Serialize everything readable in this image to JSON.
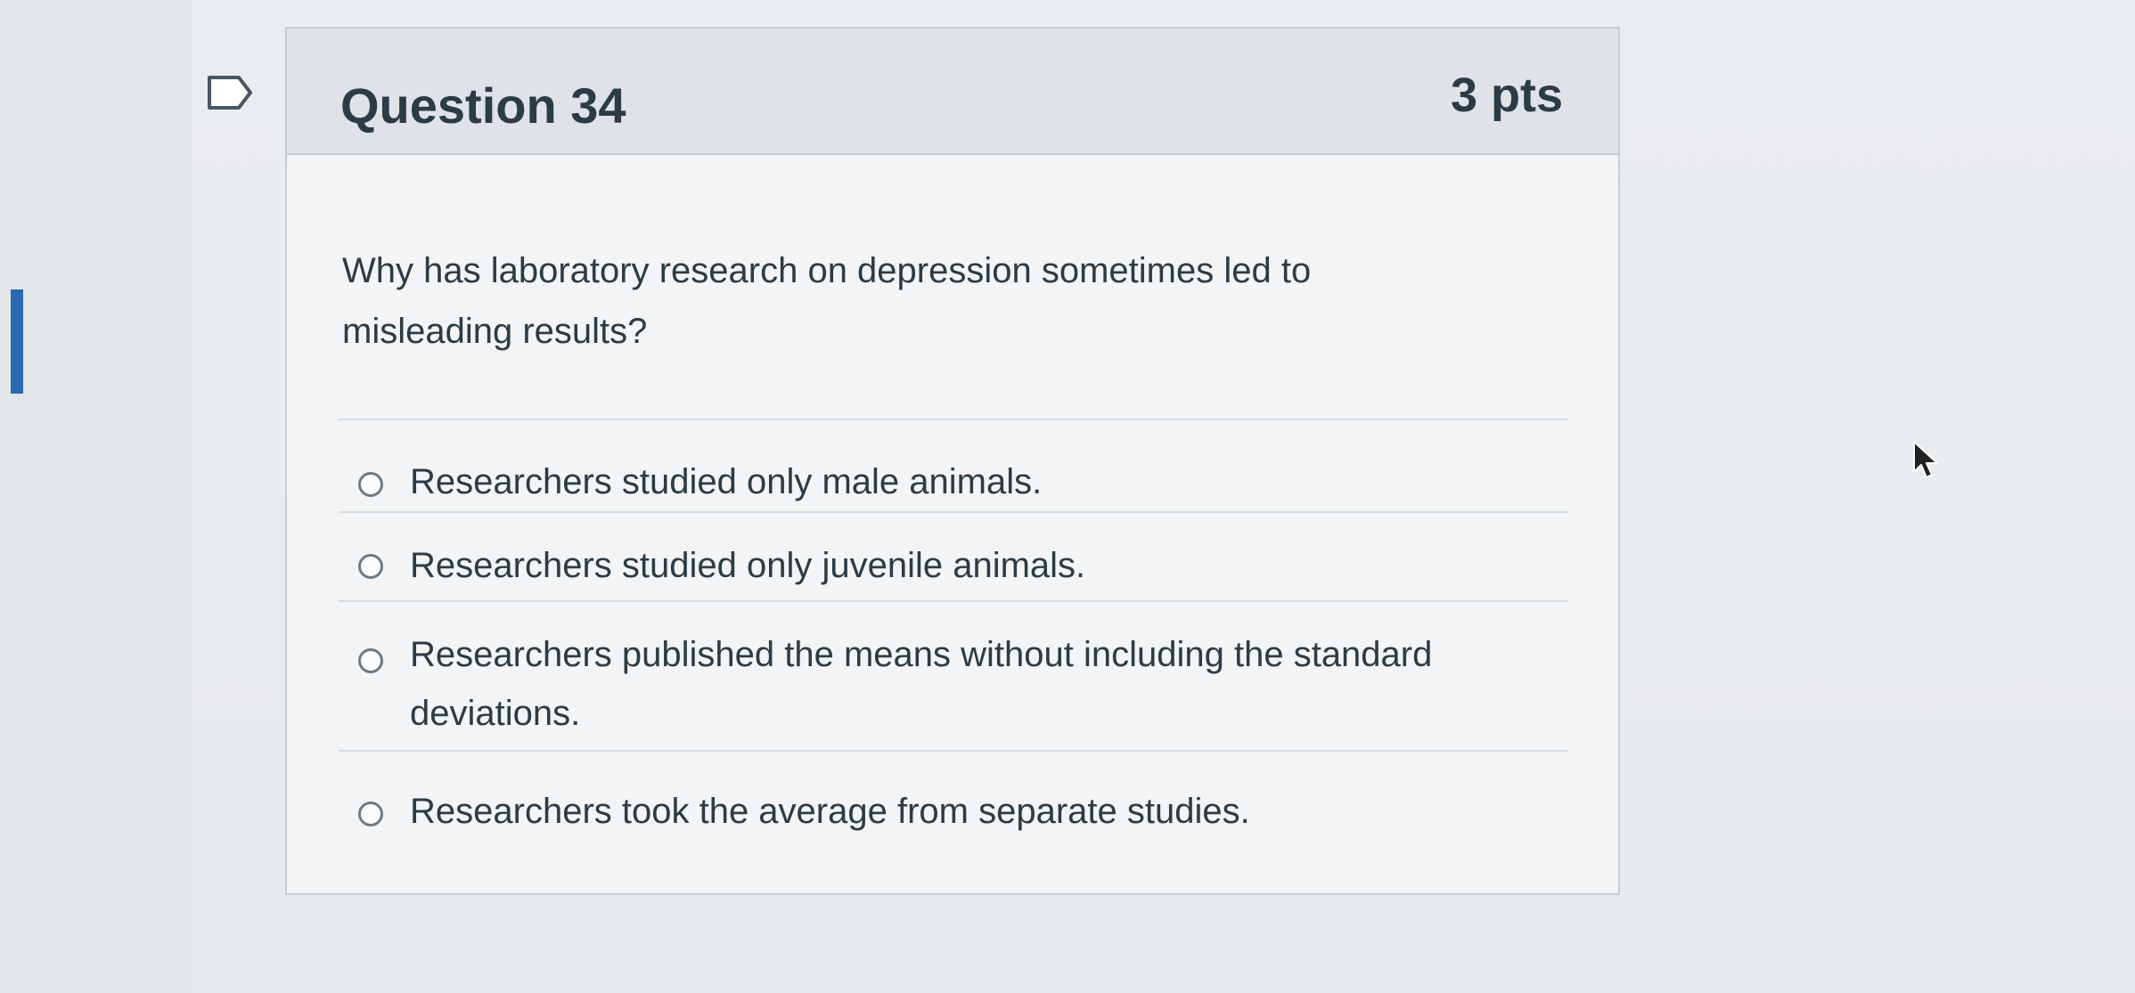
{
  "question": {
    "title": "Question 34",
    "points": "3 pts",
    "text": "Why has laboratory research on depression sometimes led to misleading results?"
  },
  "answers": [
    {
      "label": "Researchers studied only male animals.",
      "selected": false
    },
    {
      "label": "Researchers studied only juvenile animals.",
      "selected": false
    },
    {
      "label": "Researchers published the means without including the standard deviations.",
      "selected": false
    },
    {
      "label": "Researchers took the average from separate studies.",
      "selected": false
    }
  ],
  "icons": {
    "flag": "flag-question-icon",
    "cursor": "mouse-pointer-icon"
  },
  "colors": {
    "text": "#2d3b45",
    "header_bg": "#dfe3e7",
    "border": "#c8cdd2",
    "accent": "#2b6ab0"
  }
}
